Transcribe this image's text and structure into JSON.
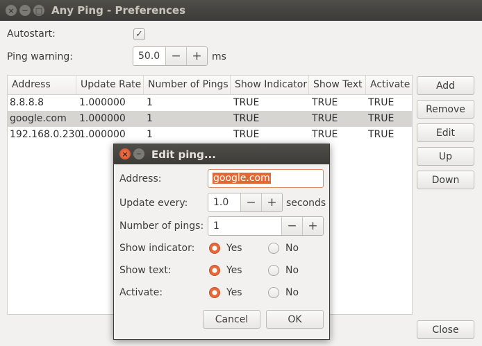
{
  "window": {
    "title": "Any Ping - Preferences",
    "close_symbol": "×",
    "min_symbol": "−",
    "max_symbol": "□"
  },
  "prefs": {
    "autostart_label": "Autostart:",
    "autostart_checked": true,
    "autostart_check_glyph": "✓",
    "ping_warning_label": "Ping warning:",
    "ping_warning_value": "50.0",
    "ping_warning_unit": "ms",
    "minus": "−",
    "plus": "+"
  },
  "table": {
    "columns": [
      "Address",
      "Update Rate",
      "Number of Pings",
      "Show Indicator",
      "Show Text",
      "Activate"
    ],
    "rows": [
      {
        "address": "8.8.8.8",
        "rate": "1.000000",
        "pings": "1",
        "indicator": "TRUE",
        "text": "TRUE",
        "activate": "TRUE"
      },
      {
        "address": "google.com",
        "rate": "1.000000",
        "pings": "1",
        "indicator": "TRUE",
        "text": "TRUE",
        "activate": "TRUE"
      },
      {
        "address": "192.168.0.230",
        "rate": "1.000000",
        "pings": "1",
        "indicator": "TRUE",
        "text": "TRUE",
        "activate": "TRUE"
      }
    ],
    "selected_row": 1
  },
  "side_buttons": {
    "add": "Add",
    "remove": "Remove",
    "edit": "Edit",
    "up": "Up",
    "down": "Down",
    "close": "Close"
  },
  "dialog": {
    "title": "Edit ping...",
    "address_label": "Address:",
    "address_value": "google.com",
    "update_label": "Update every:",
    "update_value": "1.0",
    "update_unit": "seconds",
    "pings_label": "Number of pings:",
    "pings_value": "1",
    "indicator_label": "Show indicator:",
    "text_label": "Show text:",
    "activate_label": "Activate:",
    "yes": "Yes",
    "no": "No",
    "show_indicator": "Yes",
    "show_text": "Yes",
    "activate": "Yes",
    "cancel": "Cancel",
    "ok": "OK",
    "close_symbol": "×",
    "min_symbol": "−"
  },
  "colors": {
    "accent": "#e06a35",
    "titlebar": "#3c3b37",
    "selection_row": "#d6d5d2"
  }
}
